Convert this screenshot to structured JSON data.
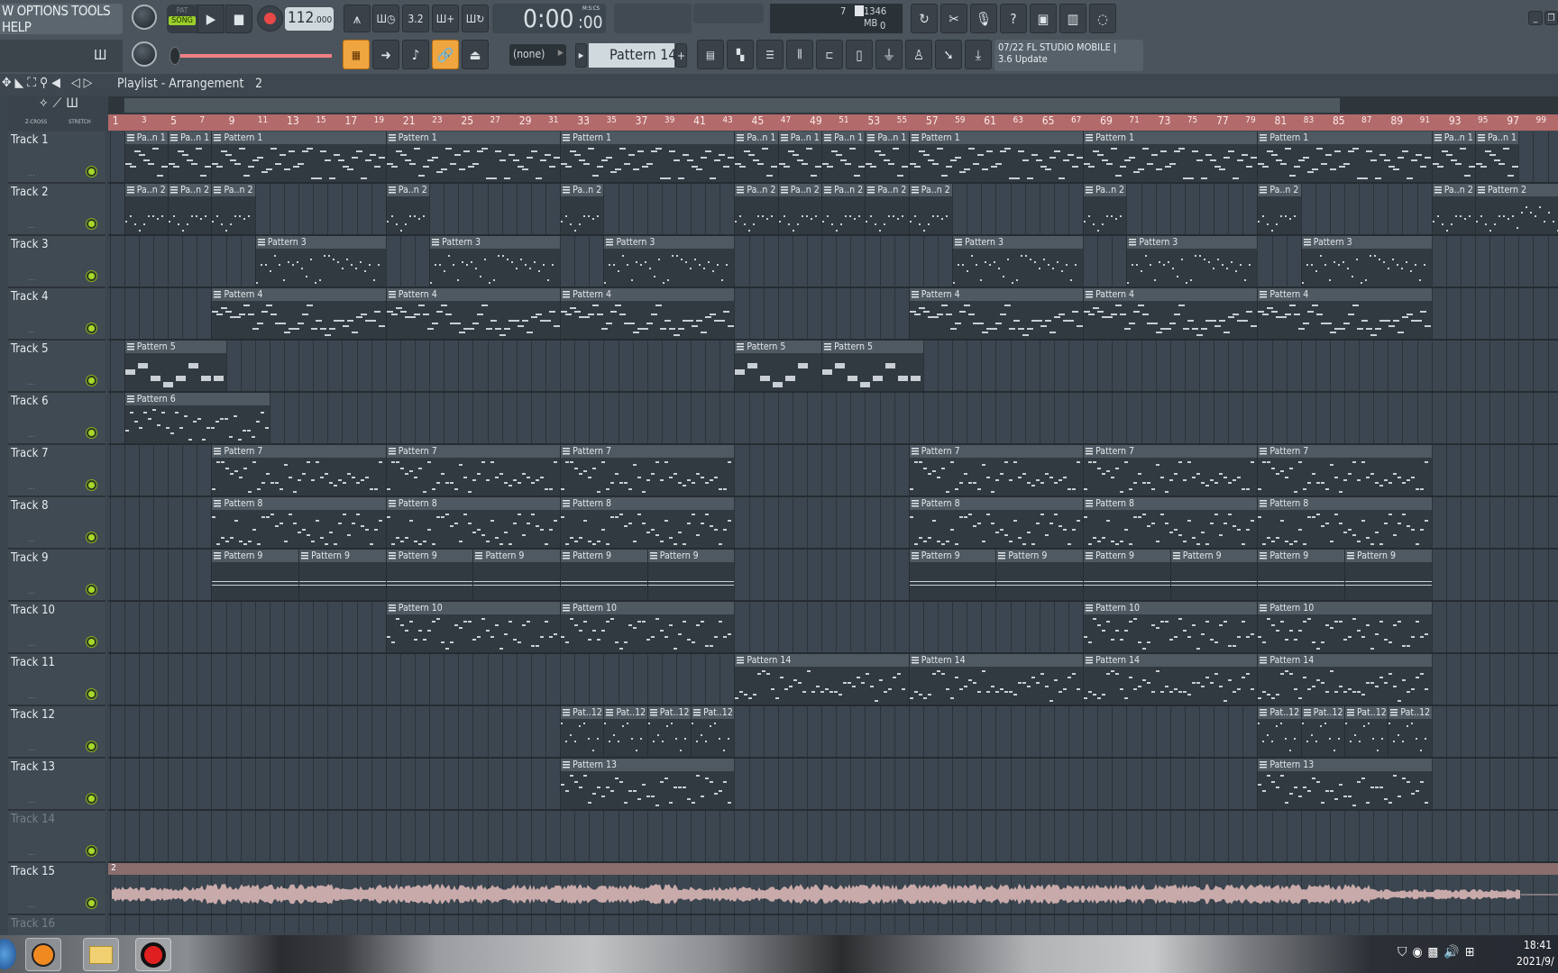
{
  "menu": {
    "text": "W OPTIONS TOOLS HELP"
  },
  "transport": {
    "pat": "PAT",
    "song": "SONG",
    "tempo": "112",
    "tempo_frac": ".000",
    "time": "0:00",
    "time_cs": ":00",
    "time_format": "M:S:CS",
    "mode": "SONG"
  },
  "monitor": {
    "cpu": "7",
    "memory": "1346 MB",
    "voices": "0"
  },
  "toolbar2": {
    "snap": "(none)",
    "pattern": "Pattern 14",
    "add": "+"
  },
  "news": {
    "line1": "07/22  FL STUDIO MOBILE |",
    "line2": "3.6 Update"
  },
  "playlist": {
    "title": "Playlist - Arrangement",
    "arrangement": "2",
    "zcross": "Z-CROSS",
    "stretch": "STRETCH"
  },
  "ruler": {
    "labels": [
      1,
      3,
      5,
      7,
      9,
      11,
      13,
      15,
      17,
      19,
      21,
      23,
      25,
      27,
      29,
      31,
      33,
      35,
      37,
      39,
      41,
      43,
      45,
      47,
      49,
      51,
      53,
      55,
      57,
      59,
      61,
      63,
      65,
      67,
      69,
      71,
      73,
      75,
      77,
      79,
      81,
      83,
      85,
      87,
      89,
      91,
      93,
      95,
      97,
      99
    ]
  },
  "colors": {
    "ruler": "#b26a6a",
    "accent": "#f0a640",
    "led": "#a8d82a",
    "audio": "#c9aaaa"
  },
  "tracks": [
    {
      "name": "Track 1",
      "clips": [
        [
          "Pa..n 1",
          2,
          3
        ],
        [
          "Pa..n 1",
          5,
          3
        ],
        [
          "Pattern 1",
          8,
          12
        ],
        [
          "Pattern 1",
          20,
          12
        ],
        [
          "Pattern 1",
          32,
          12
        ],
        [
          "Pa..n 1",
          44,
          3
        ],
        [
          "Pa..n 1",
          47,
          3
        ],
        [
          "Pa..n 1",
          50,
          3
        ],
        [
          "Pa..n 1",
          53,
          3
        ],
        [
          "Pattern 1",
          56,
          12
        ],
        [
          "Pattern 1",
          68,
          12
        ],
        [
          "Pattern 1",
          80,
          12
        ],
        [
          "Pa..n 1",
          92,
          3
        ],
        [
          "Pa..n 1",
          95,
          3
        ]
      ]
    },
    {
      "name": "Track 2",
      "clips": [
        [
          "Pa..n 2",
          2,
          3
        ],
        [
          "Pa..n 2",
          5,
          3
        ],
        [
          "Pa..n 2",
          8,
          3
        ],
        [
          "Pa..n 2",
          20,
          3
        ],
        [
          "Pa..n 2",
          32,
          3
        ],
        [
          "Pa..n 2",
          44,
          3
        ],
        [
          "Pa..n 2",
          47,
          3
        ],
        [
          "Pa..n 2",
          50,
          3
        ],
        [
          "Pa..n 2",
          53,
          3
        ],
        [
          "Pa..n 2",
          56,
          3
        ],
        [
          "Pa..n 2",
          68,
          3
        ],
        [
          "Pa..n 2",
          80,
          3
        ],
        [
          "Pa..n 2",
          92,
          3
        ],
        [
          "Pattern 2",
          95,
          8
        ]
      ]
    },
    {
      "name": "Track 3",
      "clips": [
        [
          "Pattern 3",
          11,
          9
        ],
        [
          "Pattern 3",
          23,
          9
        ],
        [
          "Pattern 3",
          35,
          9
        ],
        [
          "Pattern 3",
          59,
          9
        ],
        [
          "Pattern 3",
          71,
          9
        ],
        [
          "Pattern 3",
          83,
          9
        ]
      ]
    },
    {
      "name": "Track 4",
      "clips": [
        [
          "Pattern 4",
          8,
          12
        ],
        [
          "Pattern 4",
          20,
          12
        ],
        [
          "Pattern 4",
          32,
          12
        ],
        [
          "Pattern 4",
          56,
          12
        ],
        [
          "Pattern 4",
          68,
          12
        ],
        [
          "Pattern 4",
          80,
          12
        ]
      ]
    },
    {
      "name": "Track 5",
      "clips": [
        [
          "Pattern 5",
          2,
          7
        ],
        [
          "Pattern 5",
          44,
          6
        ],
        [
          "Pattern 5",
          50,
          7
        ]
      ]
    },
    {
      "name": "Track 6",
      "clips": [
        [
          "Pattern 6",
          2,
          10
        ]
      ]
    },
    {
      "name": "Track 7",
      "clips": [
        [
          "Pattern 7",
          8,
          12
        ],
        [
          "Pattern 7",
          20,
          12
        ],
        [
          "Pattern 7",
          32,
          12
        ],
        [
          "Pattern 7",
          56,
          12
        ],
        [
          "Pattern 7",
          68,
          12
        ],
        [
          "Pattern 7",
          80,
          12
        ]
      ]
    },
    {
      "name": "Track 8",
      "clips": [
        [
          "Pattern 8",
          8,
          12
        ],
        [
          "Pattern 8",
          20,
          12
        ],
        [
          "Pattern 8",
          32,
          12
        ],
        [
          "Pattern 8",
          56,
          12
        ],
        [
          "Pattern 8",
          68,
          12
        ],
        [
          "Pattern 8",
          80,
          12
        ]
      ]
    },
    {
      "name": "Track 9",
      "clips": [
        [
          "Pattern 9",
          8,
          6
        ],
        [
          "Pattern 9",
          14,
          6
        ],
        [
          "Pattern 9",
          20,
          6
        ],
        [
          "Pattern 9",
          26,
          6
        ],
        [
          "Pattern 9",
          32,
          6
        ],
        [
          "Pattern 9",
          38,
          6
        ],
        [
          "Pattern 9",
          56,
          6
        ],
        [
          "Pattern 9",
          62,
          6
        ],
        [
          "Pattern 9",
          68,
          6
        ],
        [
          "Pattern 9",
          74,
          6
        ],
        [
          "Pattern 9",
          80,
          6
        ],
        [
          "Pattern 9",
          86,
          6
        ]
      ]
    },
    {
      "name": "Track 10",
      "clips": [
        [
          "Pattern 10",
          20,
          12
        ],
        [
          "Pattern 10",
          32,
          12
        ],
        [
          "Pattern 10",
          68,
          12
        ],
        [
          "Pattern 10",
          80,
          12
        ]
      ]
    },
    {
      "name": "Track 11",
      "clips": [
        [
          "Pattern 14",
          44,
          12
        ],
        [
          "Pattern 14",
          56,
          12
        ],
        [
          "Pattern 14",
          68,
          12
        ],
        [
          "Pattern 14",
          80,
          12
        ]
      ]
    },
    {
      "name": "Track 12",
      "clips": [
        [
          "Pat..12",
          32,
          3
        ],
        [
          "Pat..12",
          35,
          3
        ],
        [
          "Pat..12",
          38,
          3
        ],
        [
          "Pat..12",
          41,
          3
        ],
        [
          "Pat..12",
          80,
          3
        ],
        [
          "Pat..12",
          83,
          3
        ],
        [
          "Pat..12",
          86,
          3
        ],
        [
          "Pat..12",
          89,
          3
        ]
      ]
    },
    {
      "name": "Track 13",
      "clips": [
        [
          "Pattern 13",
          32,
          12
        ],
        [
          "Pattern 13",
          80,
          12
        ]
      ]
    },
    {
      "name": "Track 14",
      "dim": true,
      "clips": []
    },
    {
      "name": "Track 15",
      "audio": {
        "label": "2",
        "start": 1,
        "end": 98
      },
      "clips": []
    },
    {
      "name": "Track 16",
      "dim": true,
      "clips": []
    }
  ],
  "taskbar": {
    "time": "18:41",
    "date": "2021/9/"
  }
}
